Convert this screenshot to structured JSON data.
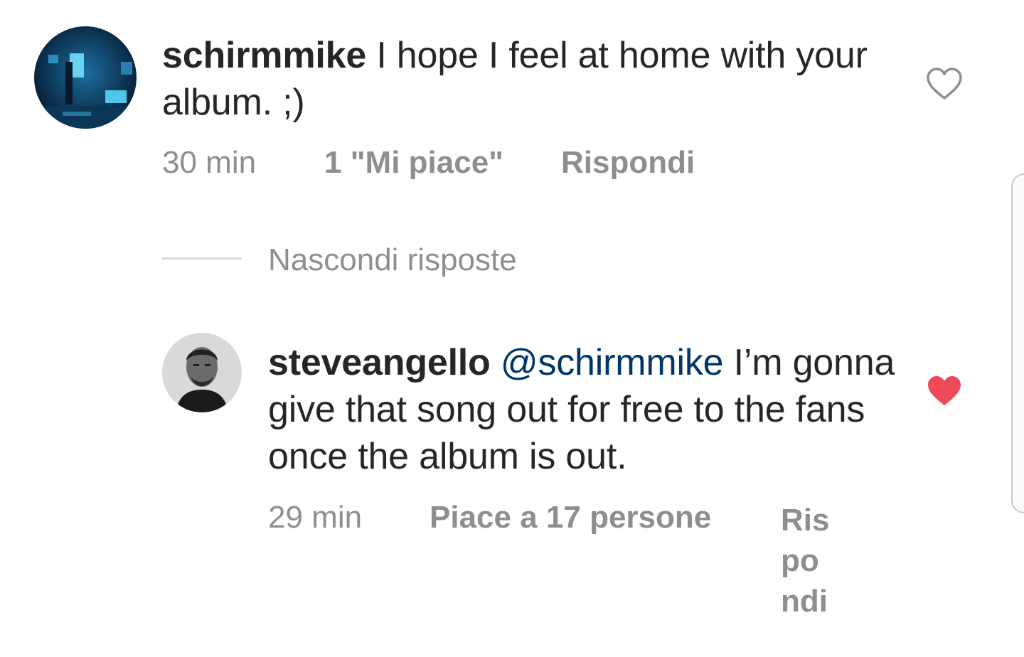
{
  "comments": [
    {
      "username": "schirmmike",
      "text": "I hope I feel at home with your album. ;)",
      "time": "30 min",
      "likes": "1 \"Mi piace\"",
      "reply": "Rispondi",
      "liked": false,
      "avatar_icon": "profile-photo-dark-blue-room"
    },
    {
      "username": "steveangello",
      "mention": "@schirmmike",
      "text": "I’m gonna give that song out for free to the fans once the album is out.",
      "time": "29 min",
      "likes": "Piace a 17 persone",
      "reply": "Rispondi",
      "liked": true,
      "avatar_icon": "profile-photo-bw-portrait"
    }
  ],
  "hide_replies": "Nascondi risposte",
  "colors": {
    "text": "#262626",
    "meta": "#8e8e8e",
    "mention": "#003569",
    "heart_liked": "#ed4956",
    "heart_outline": "#8e8e8e"
  }
}
